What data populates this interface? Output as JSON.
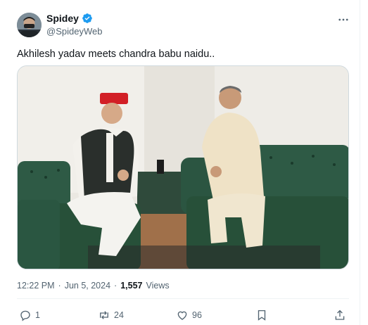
{
  "author": {
    "display_name": "Spidey",
    "handle": "@SpideyWeb",
    "verified_icon": "verified-badge-icon",
    "verified_color": "#1d9bf0"
  },
  "tweet": {
    "text": "Akhilesh yadav meets chandra babu naidu.."
  },
  "meta": {
    "time": "12:22 PM",
    "separator": "·",
    "date": "Jun 5, 2024",
    "views_count": "1,557",
    "views_label": "Views"
  },
  "actions": {
    "replies": "1",
    "reposts": "24",
    "likes": "96"
  },
  "icons": {
    "more": "more-dots-icon",
    "reply": "reply-icon",
    "repost": "repost-icon",
    "like": "heart-icon",
    "bookmark": "bookmark-icon",
    "share": "share-icon"
  },
  "colors": {
    "text_primary": "#0f1419",
    "text_secondary": "#536471",
    "border": "#cfd9de"
  }
}
